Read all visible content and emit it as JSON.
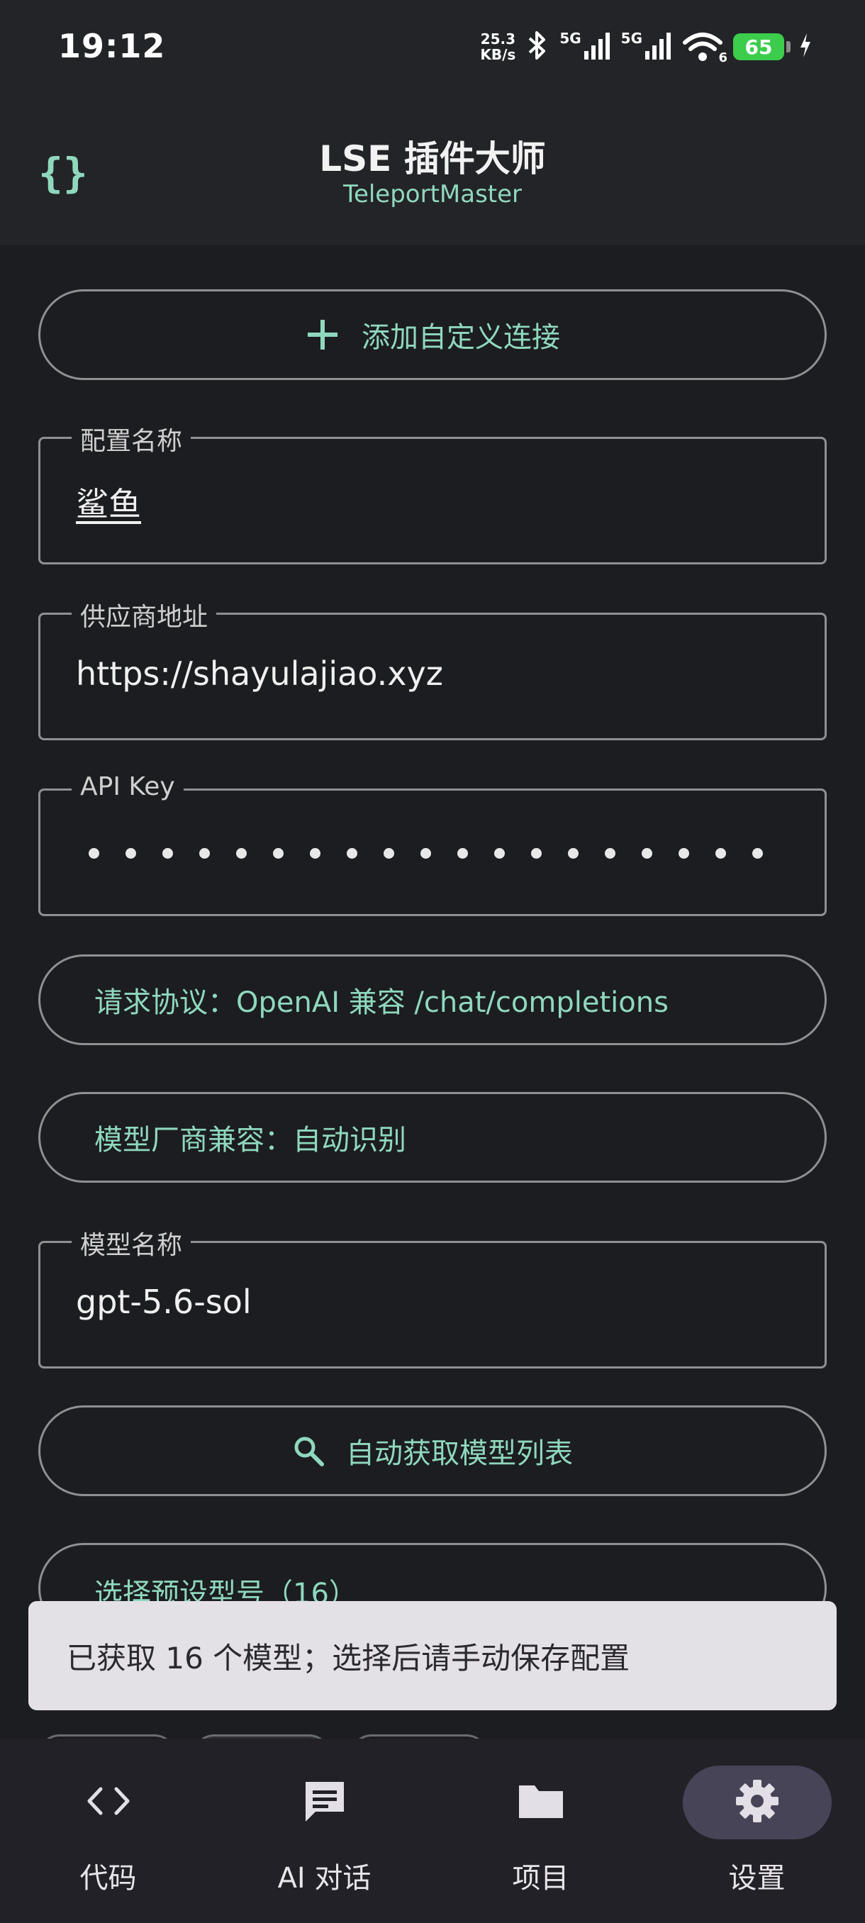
{
  "status_bar": {
    "time": "19:12",
    "net_speed_value": "25.3",
    "net_speed_unit": "KB/s",
    "signal1_label": "5G",
    "signal2_label": "5G",
    "wifi_badge": "6",
    "battery": "65"
  },
  "app_bar": {
    "logo_glyph": "{}",
    "title": "LSE 插件大师",
    "subtitle": "TeleportMaster"
  },
  "form": {
    "add_custom_connection": "添加自定义连接",
    "config_name": {
      "label": "配置名称",
      "value": "鲨鱼"
    },
    "provider_url": {
      "label": "供应商地址",
      "value": "https://shayulajiao.xyz"
    },
    "api_key": {
      "label": "API Key",
      "masked_dot_count": 20
    },
    "request_protocol": "请求协议：OpenAI 兼容 /chat/completions",
    "model_vendor_compat": "模型厂商兼容：自动识别",
    "model_name": {
      "label": "模型名称",
      "value": "gpt-5.6-sol"
    },
    "auto_fetch_models": "自动获取模型列表",
    "select_preset_model": "选择预设型号（16）"
  },
  "snackbar": {
    "message": "已获取 16 个模型；选择后请手动保存配置"
  },
  "bottom_nav": [
    {
      "label": "代码",
      "icon": "code-icon",
      "active": false
    },
    {
      "label": "AI 对话",
      "icon": "chat-icon",
      "active": false
    },
    {
      "label": "项目",
      "icon": "folder-icon",
      "active": false
    },
    {
      "label": "设置",
      "icon": "gear-icon",
      "active": true
    }
  ],
  "colors": {
    "accent": "#8fd8bd",
    "background": "#1c1d20",
    "bar": "#232427",
    "nav": "#222127",
    "nav_indicator": "#474457",
    "outline": "#8d9192",
    "battery": "#3ccd4d",
    "snackbar": "#e3e0e6"
  }
}
